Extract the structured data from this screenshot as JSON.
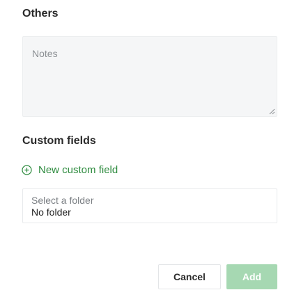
{
  "others": {
    "title": "Others",
    "notes_placeholder": "Notes"
  },
  "custom_fields": {
    "title": "Custom fields",
    "new_field_label": "New custom field",
    "icon": "plus-circle-icon"
  },
  "folder": {
    "label": "Select a folder",
    "value": "No folder"
  },
  "actions": {
    "cancel_label": "Cancel",
    "add_label": "Add"
  },
  "colors": {
    "accent": "#2c8a3d",
    "add_button_disabled": "#a6d8b2"
  }
}
